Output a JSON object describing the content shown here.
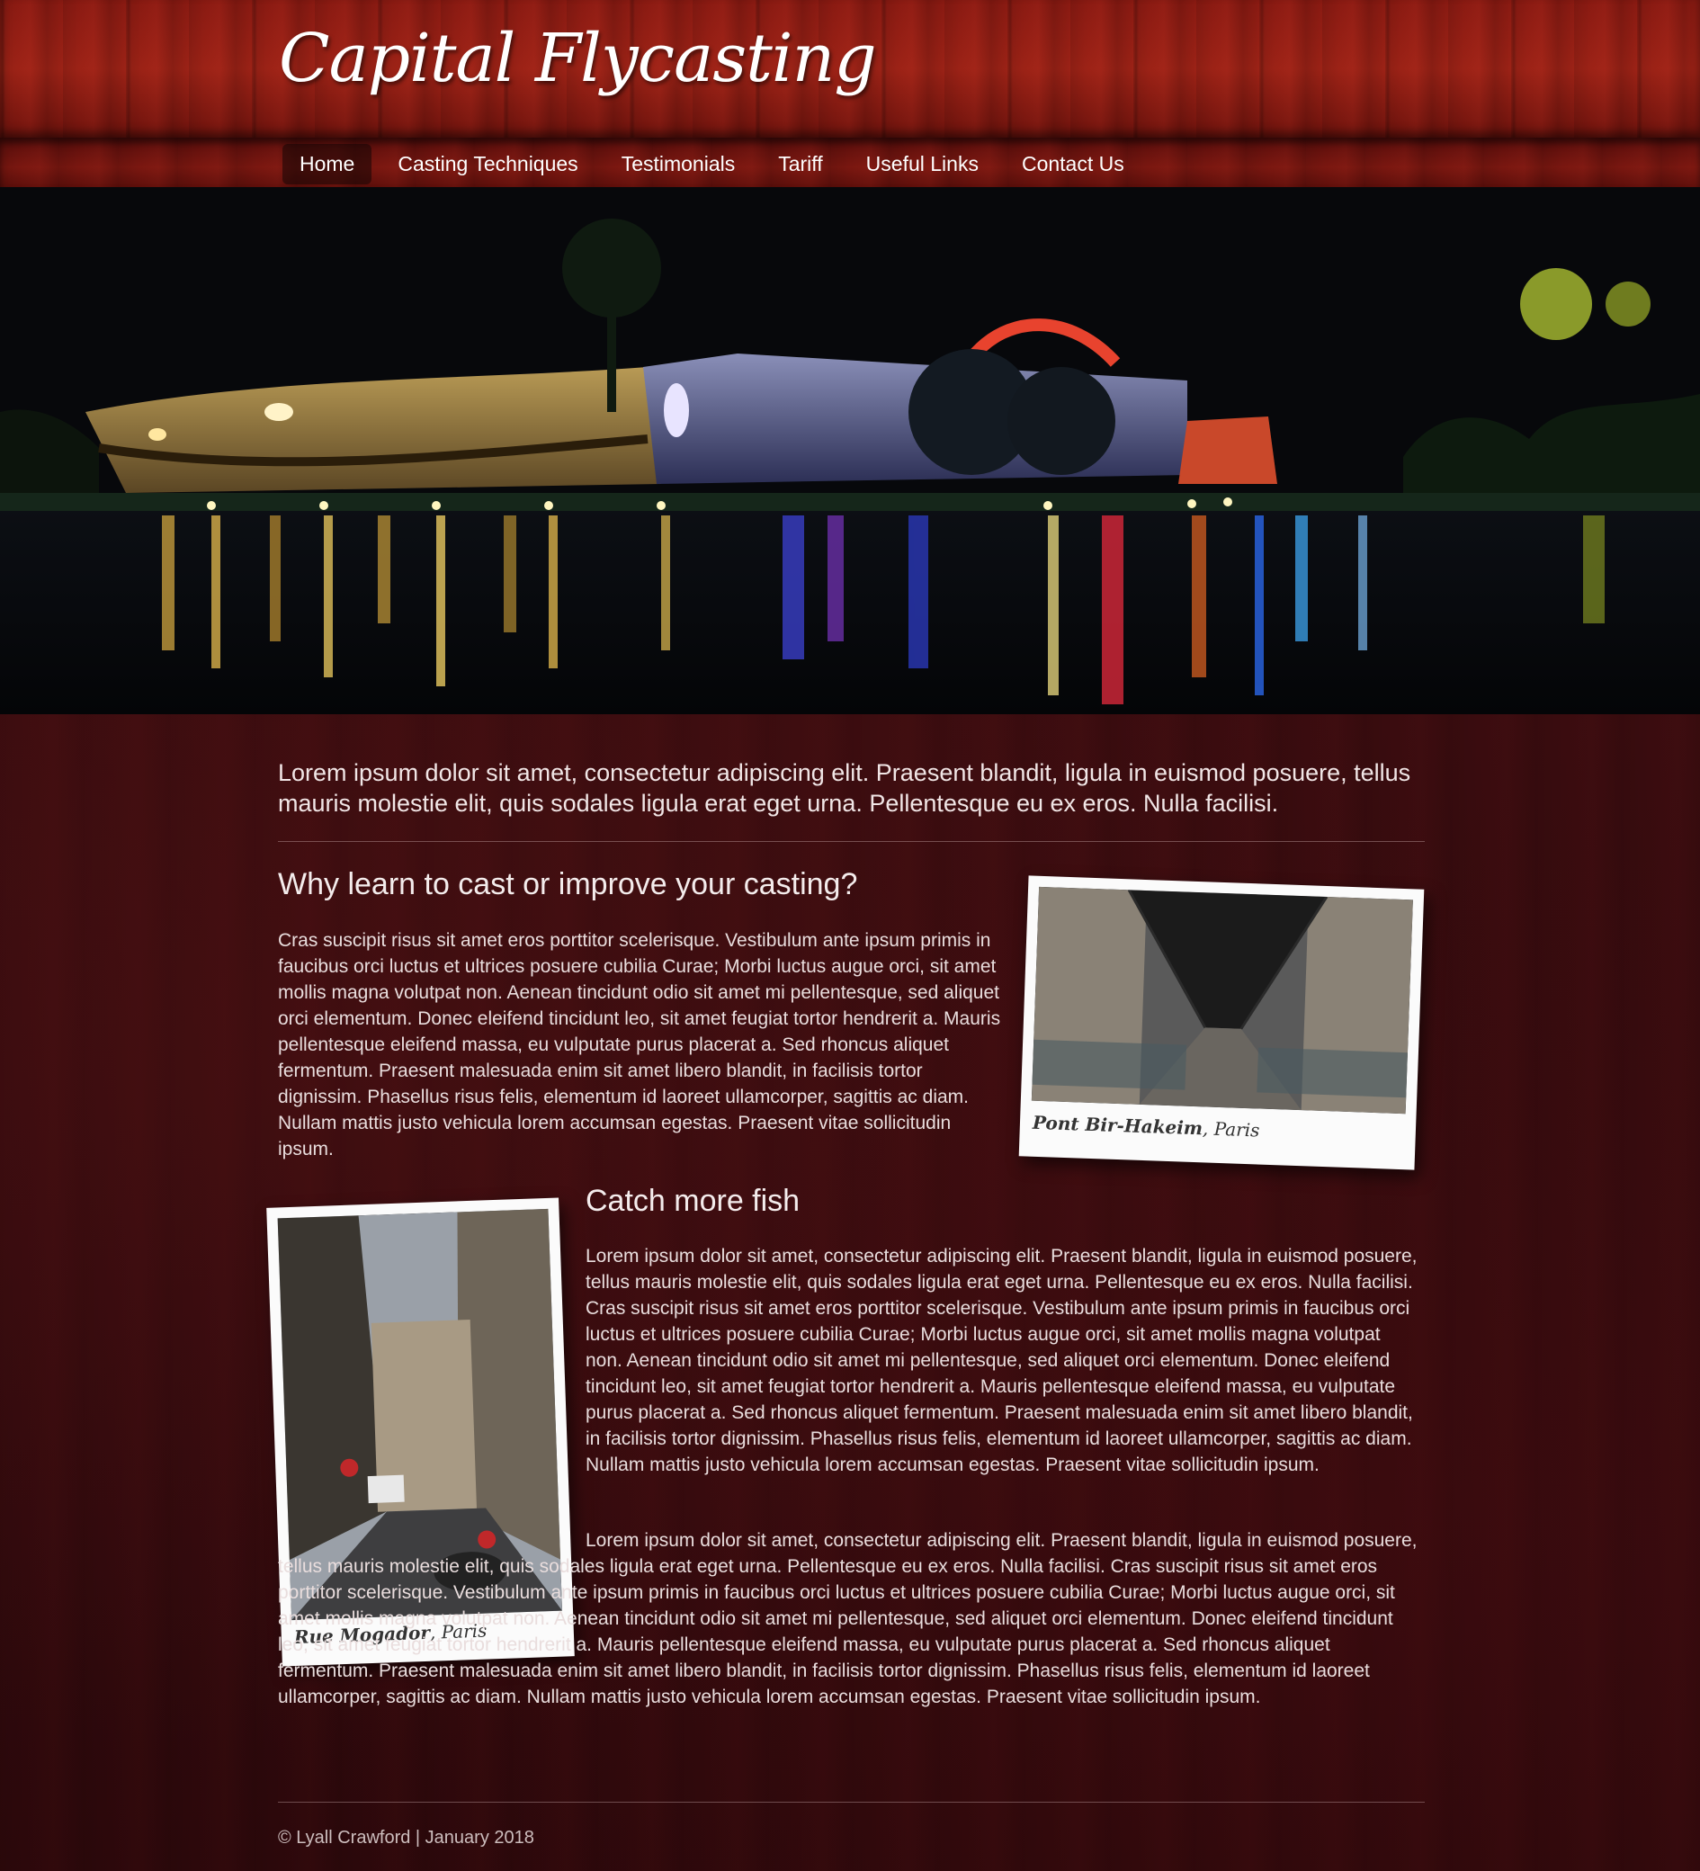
{
  "site": {
    "logo": "Capital Flycasting"
  },
  "nav": {
    "items": [
      "Home",
      "Casting Techniques",
      "Testimonials",
      "Tariff",
      "Useful Links",
      "Contact Us"
    ],
    "active": "Home"
  },
  "hero": {
    "image": "night-waterfront-scene"
  },
  "intro": "Lorem ipsum dolor sit amet, consectetur adipiscing elit. Praesent blandit, ligula in euismod posuere, tellus mauris molestie elit, quis sodales ligula erat eget urna. Pellentesque eu ex eros. Nulla facilisi.",
  "section1": {
    "heading": "Why learn to cast or improve your casting?",
    "text": "Cras suscipit risus sit amet eros porttitor scelerisque. Vestibulum ante ipsum primis in faucibus orci luctus et ultrices posuere cubilia Curae; Morbi luctus augue orci, sit amet mollis magna volutpat non. Aenean tincidunt odio sit amet mi pellentesque, sed aliquet orci elementum. Donec eleifend tincidunt leo, sit amet feugiat tortor hendrerit a. Mauris pellentesque eleifend massa, eu vulputate purus placerat a. Sed rhoncus aliquet fermentum. Praesent malesuada enim sit amet libero blandit, in facilisis tortor dignissim. Phasellus risus felis, elementum id laoreet ullamcorper, sagittis ac diam. Nullam mattis justo vehicula lorem accumsan egestas. Praesent vitae sollicitudin ipsum.",
    "photo": {
      "place": "Pont Bir-Hakeim",
      "city": ", Paris"
    }
  },
  "section2": {
    "heading": "Catch more fish",
    "para1": "Lorem ipsum dolor sit amet, consectetur adipiscing elit. Praesent blandit, ligula in euismod posuere, tellus mauris molestie elit, quis sodales ligula erat eget urna. Pellentesque eu ex eros. Nulla facilisi. Cras suscipit risus sit amet eros porttitor scelerisque. Vestibulum ante ipsum primis in faucibus orci luctus et ultrices posuere cubilia Curae; Morbi luctus augue orci, sit amet mollis magna volutpat non. Aenean tincidunt odio sit amet mi pellentesque, sed aliquet orci elementum. Donec eleifend tincidunt leo, sit amet feugiat tortor hendrerit a. Mauris pellentesque eleifend massa, eu vulputate purus placerat a. Sed rhoncus aliquet fermentum. Praesent malesuada enim sit amet libero blandit, in facilisis tortor dignissim. Phasellus risus felis, elementum id laoreet ullamcorper, sagittis ac diam. Nullam mattis justo vehicula lorem accumsan egestas. Praesent vitae sollicitudin ipsum.",
    "para2": "Lorem ipsum dolor sit amet, consectetur adipiscing elit. Praesent blandit, ligula in euismod posuere, tellus mauris molestie elit, quis sodales ligula erat eget urna. Pellentesque eu ex eros. Nulla facilisi. Cras suscipit risus sit amet eros porttitor scelerisque. Vestibulum ante ipsum primis in faucibus orci luctus et ultrices posuere cubilia Curae; Morbi luctus augue orci, sit amet mollis magna volutpat non. Aenean tincidunt odio sit amet mi pellentesque, sed aliquet orci elementum. Donec eleifend tincidunt leo, sit amet feugiat tortor hendrerit a. Mauris pellentesque eleifend massa, eu vulputate purus placerat a. Sed rhoncus aliquet fermentum. Praesent malesuada enim sit amet libero blandit, in facilisis tortor dignissim. Phasellus risus felis, elementum id laoreet ullamcorper, sagittis ac diam. Nullam mattis justo vehicula lorem accumsan egestas. Praesent vitae sollicitudin ipsum.",
    "photo": {
      "place": "Rue Mogador",
      "city": ", Paris"
    }
  },
  "footer": {
    "text": "© Lyall Crawford | January 2018"
  },
  "colors": {
    "header": "#8a1a12",
    "content_bg": "#320a0d",
    "text": "#e9dddd"
  }
}
